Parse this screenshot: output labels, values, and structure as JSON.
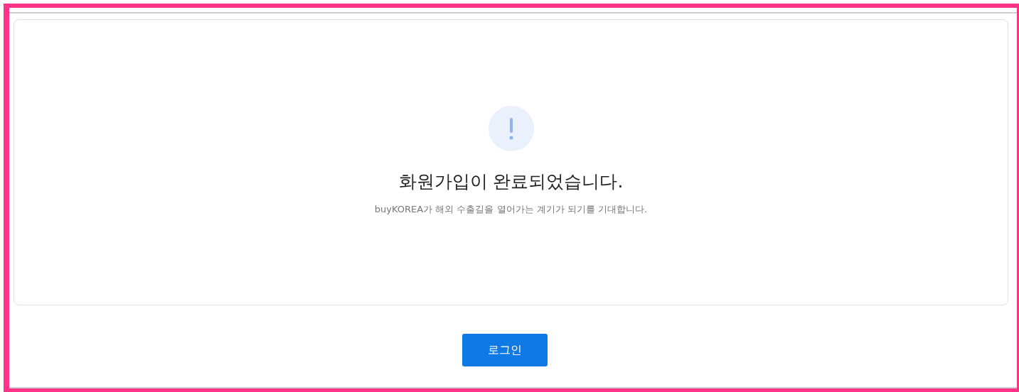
{
  "message": {
    "title": "화원가입이 완료되었습니다.",
    "subtitle": "buyKOREA가 해외 수출길을 열어가는 계기가 되기를 기대합니다."
  },
  "buttons": [
    {
      "label": "로그인"
    }
  ]
}
